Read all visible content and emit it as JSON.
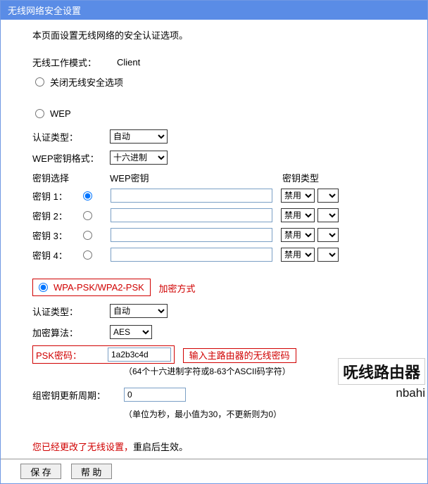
{
  "title": "无线网络安全设置",
  "desc": "本页面设置无线网络的安全认证选项。",
  "mode_label": "无线工作模式：",
  "mode_value": "Client",
  "opt_disable": "关闭无线安全选项",
  "opt_wep": "WEP",
  "auth_type_label": "认证类型：",
  "auth_type_value": "自动",
  "wep_fmt_label": "WEP密钥格式：",
  "wep_fmt_value": "十六进制",
  "key_select_label": "密钥选择",
  "wep_key_label": "WEP密钥",
  "key_type_label": "密钥类型",
  "keys": [
    {
      "label": "密钥 1：",
      "type": "禁用"
    },
    {
      "label": "密钥 2：",
      "type": "禁用"
    },
    {
      "label": "密钥 3：",
      "type": "禁用"
    },
    {
      "label": "密钥 4：",
      "type": "禁用"
    }
  ],
  "wpa_label": "WPA-PSK/WPA2-PSK",
  "wpa_annotation": "加密方式",
  "wpa_auth_label": "认证类型：",
  "wpa_auth_value": "自动",
  "alg_label": "加密算法：",
  "alg_value": "AES",
  "psk_label": "PSK密码：",
  "psk_value": "1a2b3c4d",
  "psk_annotation": "输入主路由器的无线密码",
  "psk_hint": "（64个十六进制字符或8-63个ASCII码字符）",
  "group_label": "组密钥更新周期：",
  "group_value": "0",
  "group_hint": "（单位为秒，最小值为30，不更新则为0）",
  "notice_red": "您已经更改了无线设置，",
  "notice_black": "重启后生效。",
  "save_btn": "保 存",
  "help_btn": "帮 助",
  "watermark": "呒线路由器",
  "watermark_url": "nbahi"
}
